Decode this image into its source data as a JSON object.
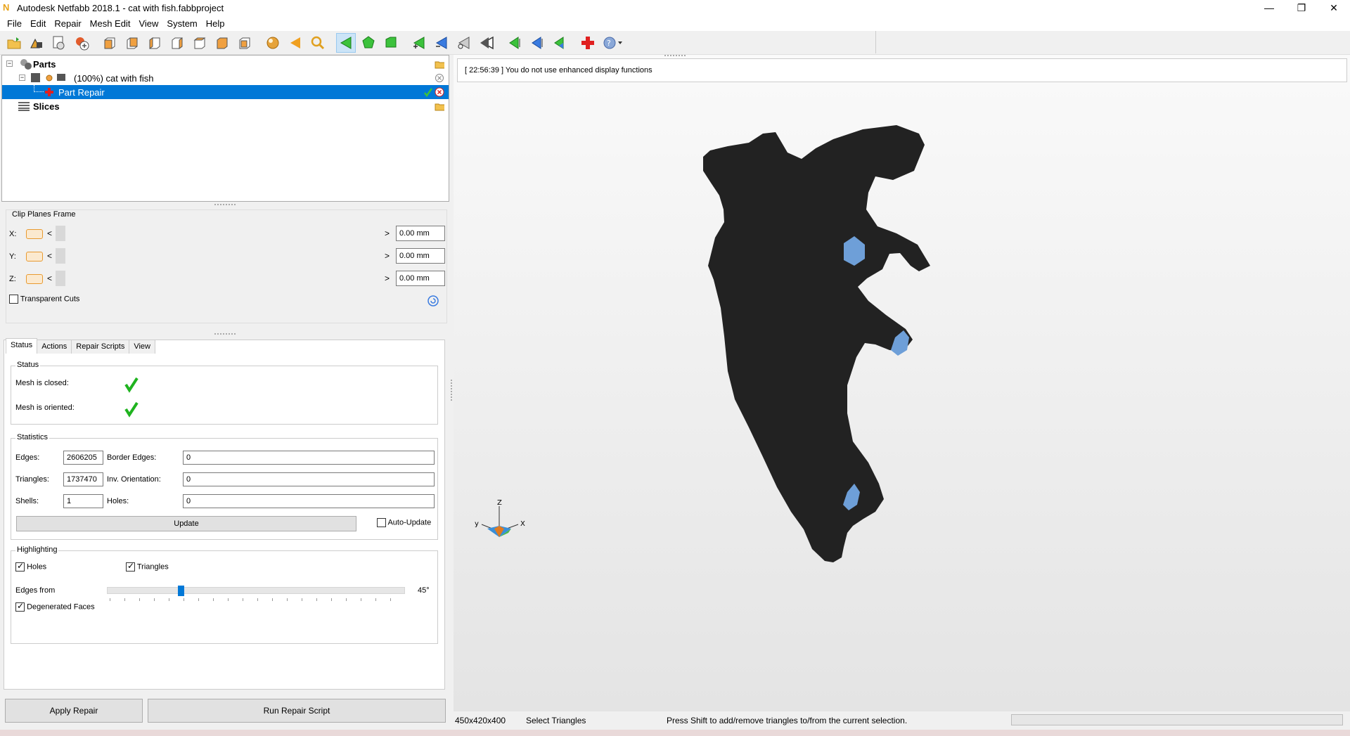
{
  "window": {
    "title": "Autodesk Netfabb 2018.1 - cat with fish.fabbproject",
    "app_icon": "N",
    "minimize": "—",
    "restore": "❐",
    "close": "✕"
  },
  "menu": [
    "File",
    "Edit",
    "Repair",
    "Mesh Edit",
    "View",
    "System",
    "Help"
  ],
  "tree": {
    "parts_label": "Parts",
    "part_label": "(100%) cat with fish",
    "repair_label": "Part Repair",
    "slices_label": "Slices"
  },
  "clip": {
    "title": "Clip Planes Frame",
    "x_label": "X:",
    "y_label": "Y:",
    "z_label": "Z:",
    "x_value": "0.00 mm",
    "y_value": "0.00 mm",
    "z_value": "0.00 mm",
    "lt": "<",
    "gt": ">",
    "transparent_label": "Transparent Cuts",
    "transparent_checked": false
  },
  "tabs": [
    "Status",
    "Actions",
    "Repair Scripts",
    "View"
  ],
  "status": {
    "group_title": "Status",
    "closed_label": "Mesh is closed:",
    "oriented_label": "Mesh is oriented:"
  },
  "statistics": {
    "group_title": "Statistics",
    "edges_label": "Edges:",
    "edges_value": "2606205",
    "border_edges_label": "Border Edges:",
    "border_edges_value": "0",
    "triangles_label": "Triangles:",
    "triangles_value": "1737470",
    "inv_orientation_label": "Inv. Orientation:",
    "inv_orientation_value": "0",
    "shells_label": "Shells:",
    "shells_value": "1",
    "holes_label": "Holes:",
    "holes_value": "0",
    "update_button": "Update",
    "auto_update_label": "Auto-Update"
  },
  "highlighting": {
    "group_title": "Highlighting",
    "holes_label": "Holes",
    "triangles_label": "Triangles",
    "edges_from_label": "Edges from",
    "edges_from_value": "45°",
    "degenerated_label": "Degenerated Faces"
  },
  "buttons": {
    "apply_repair": "Apply Repair",
    "run_repair_script": "Run Repair Script"
  },
  "viewport": {
    "message": "[ 22:56:39 ] You do not use enhanced display functions",
    "axis_z": "Z",
    "axis_y": "y",
    "axis_x": "X"
  },
  "statusbar": {
    "dims": "450x420x400",
    "mode": "Select Triangles",
    "hint": "Press Shift to add/remove triangles to/from the current selection."
  }
}
